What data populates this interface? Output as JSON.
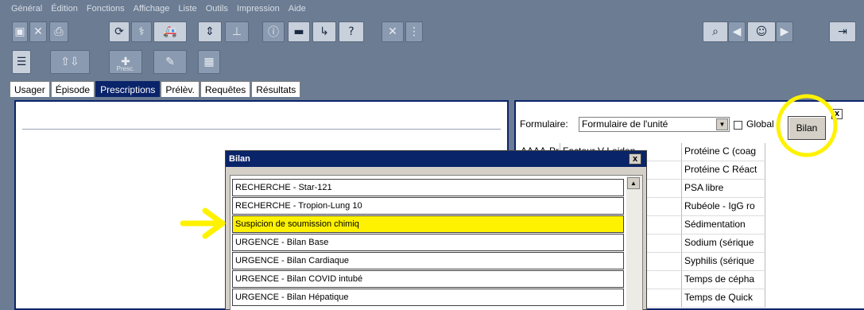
{
  "menu": [
    "Général",
    "Édition",
    "Fonctions",
    "Affichage",
    "Liste",
    "Outils",
    "Impression",
    "Aide"
  ],
  "toolbar": {
    "presc_label": "Presc."
  },
  "tabs": [
    {
      "label": "Usager",
      "active": false
    },
    {
      "label": "Épisode",
      "active": false
    },
    {
      "label": "Prescriptions",
      "active": true
    },
    {
      "label": "Prélèv.",
      "active": false
    },
    {
      "label": "Requêtes",
      "active": false
    },
    {
      "label": "Résultats",
      "active": false
    }
  ],
  "right_panel": {
    "formulaire_label": "Formulaire:",
    "formulaire_value": "Formulaire de l'unité",
    "global_label": "Global",
    "bilan_button": "Bilan",
    "close_label": "x",
    "grid_rows": [
      [
        "AAAA-Protéine",
        "Facteur V Leiden",
        "Protéine C (coag"
      ],
      [
        "",
        "",
        "Protéine C Réact"
      ],
      [
        "",
        "ue",
        "PSA libre"
      ],
      [
        "",
        "sanguin",
        "Rubéole - IgG  ro"
      ],
      [
        "",
        "",
        "Sédimentation"
      ],
      [
        "",
        "",
        "Sodium (sérique"
      ],
      [
        "",
        "",
        "Syphilis (sérique"
      ],
      [
        "",
        "A - IgM (",
        "Temps de cépha"
      ],
      [
        "",
        "9 - 3 mo",
        "Temps de Quick"
      ]
    ]
  },
  "dialog": {
    "title": "Bilan",
    "close_label": "x",
    "items": [
      "RECHERCHE - Star-121",
      "RECHERCHE - Tropion-Lung 10",
      "Suspicion de soumission chimiq",
      "URGENCE - Bilan Base",
      "URGENCE - Bilan Cardiaque",
      "URGENCE - Bilan COVID intubé",
      "URGENCE - Bilan Hépatique"
    ],
    "highlighted_index": 2
  },
  "colors": {
    "app_bg": "#6b7c93",
    "selection_blue": "#0a246a",
    "annotation_yellow": "#fff200"
  }
}
